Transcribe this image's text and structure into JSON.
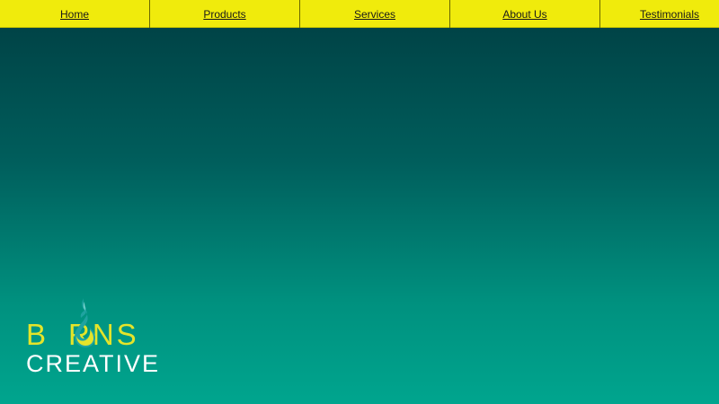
{
  "nav": {
    "items": [
      {
        "label": "Home"
      },
      {
        "label": "Products"
      },
      {
        "label": "Services"
      },
      {
        "label": "About Us"
      },
      {
        "label": "Testimonials"
      }
    ],
    "background": "#f0eb0c"
  },
  "logo": {
    "first_letter": "B",
    "rest": "RNS",
    "tagline": "CREATIVE",
    "primary_color": "#e4e42a",
    "secondary_color": "#ffffff",
    "icon": "flame-drop-icon"
  },
  "theme": {
    "gradient_top": "#003e42",
    "gradient_bottom": "#00a58e"
  }
}
